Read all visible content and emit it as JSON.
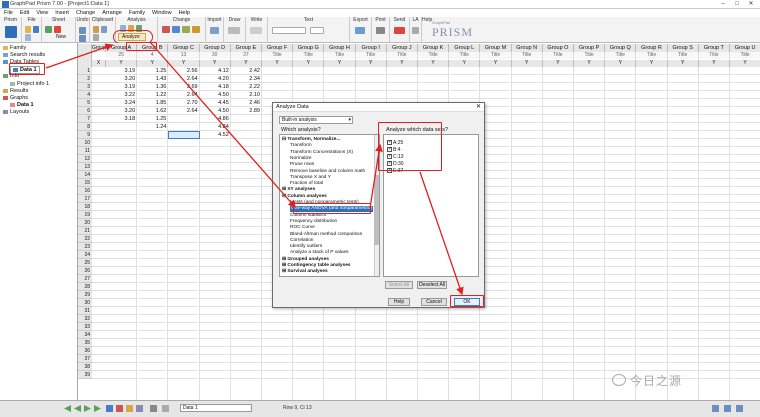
{
  "window": {
    "title": "GraphPad Prism 7.00 - [Project1:Data 1]",
    "controls": [
      "–",
      "□",
      "✕"
    ]
  },
  "menu": [
    "File",
    "Edit",
    "View",
    "Insert",
    "Change",
    "Arrange",
    "Family",
    "Window",
    "Help"
  ],
  "ribbon": {
    "groups": [
      "Prism",
      "File",
      "Sheet",
      "Undo",
      "Clipboard",
      "Analysis",
      "Change",
      "Import",
      "Draw",
      "Write",
      "Text",
      "Export",
      "Print",
      "Send",
      "LA",
      "Help"
    ],
    "analyze_label": "Analyze",
    "new_label": "New",
    "logo_small": "GraphPad",
    "logo_big": "PRISM"
  },
  "navigator": {
    "items": [
      {
        "label": "Family",
        "icon": "folder-icon"
      },
      {
        "label": "Search results",
        "icon": "search-icon"
      },
      {
        "label": "Data Tables",
        "icon": "table-icon"
      },
      {
        "label": "Data 1",
        "icon": "sheet-icon",
        "selected": true
      },
      {
        "label": "Info",
        "icon": "info-icon"
      },
      {
        "label": "Project info 1",
        "icon": "info-sheet-icon"
      },
      {
        "label": "Results",
        "icon": "results-icon"
      },
      {
        "label": "Graphs",
        "icon": "graph-icon"
      },
      {
        "label": "Data 1",
        "icon": "graph-sheet-icon",
        "bold": true
      },
      {
        "label": "Layouts",
        "icon": "layout-icon"
      }
    ]
  },
  "grid": {
    "x_header": "Group",
    "columns": [
      "Group A",
      "Group B",
      "Group C",
      "Group D",
      "Group E",
      "Group F",
      "Group G",
      "Group H",
      "Group I",
      "Group J",
      "Group K",
      "Group L",
      "Group M",
      "Group N",
      "Group O",
      "Group P",
      "Group Q",
      "Group R",
      "Group S",
      "Group T",
      "Group U"
    ],
    "subtitles": [
      "25",
      "4",
      "13",
      "30",
      "37",
      "Title",
      "Title",
      "Title",
      "Title",
      "Title",
      "Title",
      "Title",
      "Title",
      "Title",
      "Title",
      "Title",
      "Title",
      "Title",
      "Title",
      "Title",
      "Title"
    ],
    "row_numbers": [
      "1",
      "2",
      "3",
      "4",
      "5",
      "6",
      "7",
      "8",
      "9",
      "10",
      "11",
      "12",
      "13",
      "14",
      "15",
      "16",
      "17",
      "18",
      "19",
      "20",
      "21",
      "22",
      "23",
      "24",
      "25",
      "26",
      "27",
      "28",
      "29",
      "30",
      "31",
      "32",
      "33",
      "34",
      "35",
      "36",
      "37",
      "38",
      "39"
    ],
    "data": [
      [
        "3.19",
        "1.25",
        "2.56",
        "4.12",
        "2.42"
      ],
      [
        "3.20",
        "1.43",
        "2.64",
        "4.20",
        "2.34"
      ],
      [
        "3.19",
        "1.36",
        "2.69",
        "4.18",
        "2.22"
      ],
      [
        "3.22",
        "1.22",
        "2.64",
        "4.50",
        "2.10"
      ],
      [
        "3.24",
        "1.85",
        "2.70",
        "4.45",
        "2.46"
      ],
      [
        "3.20",
        "1.62",
        "2.64",
        "4.50",
        "2.89"
      ],
      [
        "3.18",
        "1.25",
        "",
        "4.86",
        ""
      ],
      [
        "",
        "1.24",
        "",
        "4.84",
        ""
      ],
      [
        "",
        "",
        "",
        "4.52",
        ""
      ]
    ]
  },
  "dialog": {
    "title": "Analyze Data",
    "close": "✕",
    "type_value": "Built-in analysis",
    "which_analysis_label": "Which analysis?",
    "which_datasets_label": "Analyze which data sets?",
    "tree": [
      {
        "label": "⊟ Transform, Normalize...",
        "indent": 0,
        "bold": true
      },
      {
        "label": "Transform",
        "indent": 2
      },
      {
        "label": "Transform Concentrations (X)",
        "indent": 2
      },
      {
        "label": "Normalize",
        "indent": 2
      },
      {
        "label": "Prune rows",
        "indent": 2
      },
      {
        "label": "Remove baseline and column math",
        "indent": 2
      },
      {
        "label": "Transpose X and Y",
        "indent": 2
      },
      {
        "label": "Fraction of total",
        "indent": 2
      },
      {
        "label": "⊞ XY analyses",
        "indent": 0,
        "bold": true
      },
      {
        "label": "⊟ Column analyses",
        "indent": 0,
        "bold": true
      },
      {
        "label": "t tests (and nonparametric tests)",
        "indent": 2
      },
      {
        "label": "One-way ANOVA (and nonparametric)",
        "indent": 2,
        "selected": true
      },
      {
        "label": "Column statistics",
        "indent": 2
      },
      {
        "label": "Frequency distribution",
        "indent": 2
      },
      {
        "label": "ROC Curve",
        "indent": 2
      },
      {
        "label": "Bland-Altman method comparison",
        "indent": 2
      },
      {
        "label": "Correlation",
        "indent": 2
      },
      {
        "label": "Identify outliers",
        "indent": 2
      },
      {
        "label": "Analyze a stack of P values",
        "indent": 2
      },
      {
        "label": "⊞ Grouped analyses",
        "indent": 0,
        "bold": true
      },
      {
        "label": "⊞ Contingency table analyses",
        "indent": 0,
        "bold": true
      },
      {
        "label": "⊞ Survival analyses",
        "indent": 0,
        "bold": true
      }
    ],
    "datasets": [
      "A:25",
      "B:4",
      "C:13",
      "D:30",
      "E:37"
    ],
    "select_all": "Select All",
    "deselect_all": "Deselect All",
    "help": "Help",
    "cancel": "Cancel",
    "ok": "OK"
  },
  "status": {
    "sheet": "Data 1",
    "rowcol": "Row 9, Ci 13"
  },
  "watermark": "今日之源",
  "colors": {
    "accent": "#2f6fb5",
    "annotation": "#e02020"
  }
}
